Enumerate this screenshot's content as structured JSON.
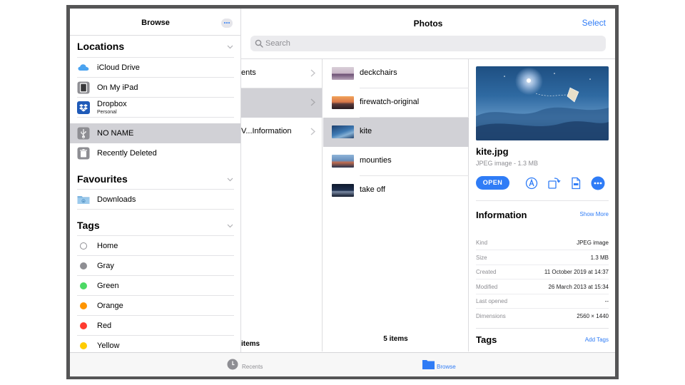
{
  "sidebar": {
    "title": "Browse",
    "sections": {
      "locations": "Locations",
      "favourites": "Favourites",
      "tags": "Tags"
    },
    "locations": [
      {
        "label": "iCloud Drive",
        "icon": "icloud-icon"
      },
      {
        "label": "On My iPad",
        "icon": "ipad-icon"
      },
      {
        "label": "Dropbox",
        "sub": "Personal",
        "icon": "dropbox-icon"
      },
      {
        "label": "NO NAME",
        "icon": "usb-icon",
        "selected": true
      },
      {
        "label": "Recently Deleted",
        "icon": "trash-icon"
      }
    ],
    "favourites": [
      {
        "label": "Downloads",
        "icon": "folder-download-icon"
      }
    ],
    "tags": [
      {
        "label": "Home",
        "color": ""
      },
      {
        "label": "Gray",
        "color": "#8e8e93"
      },
      {
        "label": "Green",
        "color": "#4cd964"
      },
      {
        "label": "Orange",
        "color": "#ff9500"
      },
      {
        "label": "Red",
        "color": "#ff3b30"
      },
      {
        "label": "Yellow",
        "color": "#ffcc00"
      }
    ]
  },
  "main": {
    "title": "Photos",
    "select_label": "Select",
    "search_placeholder": "Search"
  },
  "column1": {
    "rows": [
      {
        "label": "ents",
        "selected": false
      },
      {
        "label": "",
        "selected": true
      },
      {
        "label": "V...Information",
        "selected": false
      }
    ],
    "count": "items"
  },
  "column2": {
    "rows": [
      {
        "label": "deckchairs",
        "selected": false
      },
      {
        "label": "firewatch-original",
        "selected": false
      },
      {
        "label": "kite",
        "selected": true
      },
      {
        "label": "mounties",
        "selected": false
      },
      {
        "label": "take off",
        "selected": false
      }
    ],
    "count": "5 items"
  },
  "detail": {
    "name": "kite.jpg",
    "meta": "JPEG image - 1.3 MB",
    "open_label": "OPEN",
    "info_title": "Information",
    "show_more": "Show More",
    "info": [
      {
        "key": "Kind",
        "value": "JPEG image"
      },
      {
        "key": "Size",
        "value": "1.3 MB"
      },
      {
        "key": "Created",
        "value": "11 October 2019 at 14:37"
      },
      {
        "key": "Modified",
        "value": "26 March 2013 at 15:34"
      },
      {
        "key": "Last opened",
        "value": "--"
      },
      {
        "key": "Dimensions",
        "value": "2560 × 1440"
      }
    ],
    "tags_title": "Tags",
    "add_tags": "Add Tags"
  },
  "tabbar": {
    "recents": "Recents",
    "browse": "Browse"
  },
  "colors": {
    "accent": "#2f7cf6",
    "selection": "#d1d1d6"
  }
}
